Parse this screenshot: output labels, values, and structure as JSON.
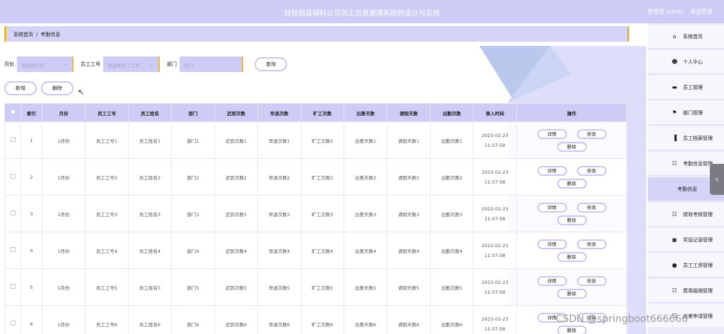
{
  "header": {
    "title": "钰铨服装辅料公司员工信息管理系统的设计与实现",
    "user_role": "管理员 admin",
    "logout": "退出登录"
  },
  "breadcrumb": {
    "home": "系统首页",
    "separator": "/",
    "current": "考勤信息"
  },
  "search": {
    "month_label": "月份",
    "month_placeholder": "请选择月份",
    "id_label": "员工工号",
    "id_placeholder": "请选择员工工号",
    "dept_label": "部门",
    "dept_placeholder": "部门",
    "search_button": "查询"
  },
  "actions": {
    "add": "新增",
    "delete": "删除"
  },
  "table": {
    "headers": [
      "索引",
      "月份",
      "员工工号",
      "员工姓名",
      "部门",
      "迟到次数",
      "早退次数",
      "旷工次数",
      "出差天数",
      "请假天数",
      "出勤次数",
      "录入时间",
      "操作"
    ],
    "op_labels": {
      "detail": "详情",
      "edit": "修改",
      "delete": "删除"
    },
    "rows": [
      [
        "1",
        "1月份",
        "员工工号1",
        "员工姓名1",
        "部门1",
        "迟到次数1",
        "早退次数1",
        "旷工次数1",
        "出差天数1",
        "请假天数1",
        "出勤次数1",
        "2023-02-23 11:07:58"
      ],
      [
        "2",
        "1月份",
        "员工工号2",
        "员工姓名2",
        "部门2",
        "迟到次数2",
        "早退次数2",
        "旷工次数2",
        "出差天数2",
        "请假天数2",
        "出勤次数2",
        "2023-02-23 11:07:58"
      ],
      [
        "3",
        "1月份",
        "员工工号3",
        "员工姓名3",
        "部门3",
        "迟到次数3",
        "早退次数3",
        "旷工次数3",
        "出差天数3",
        "请假天数3",
        "出勤次数3",
        "2023-02-23 11:07:58"
      ],
      [
        "4",
        "1月份",
        "员工工号4",
        "员工姓名4",
        "部门4",
        "迟到次数4",
        "早退次数4",
        "旷工次数4",
        "出差天数4",
        "请假天数4",
        "出勤次数4",
        "2023-02-23 11:07:58"
      ],
      [
        "5",
        "1月份",
        "员工工号5",
        "员工姓名5",
        "部门5",
        "迟到次数5",
        "早退次数5",
        "旷工次数5",
        "出差天数5",
        "请假天数5",
        "出勤次数5",
        "2023-02-23 11:07:58"
      ],
      [
        "6",
        "1月份",
        "员工工号6",
        "员工姓名6",
        "部门6",
        "迟到次数6",
        "早退次数6",
        "旷工次数6",
        "出差天数6",
        "请假天数6",
        "出勤次数6",
        "2023-02-23 11:07:58"
      ]
    ]
  },
  "sidebar": {
    "items": [
      {
        "label": "系统首页",
        "icon": "home-icon"
      },
      {
        "label": "个人中心",
        "icon": "user-icon"
      },
      {
        "label": "员工管理",
        "icon": "card-icon"
      },
      {
        "label": "部门管理",
        "icon": "flag-icon"
      },
      {
        "label": "员工档案管理",
        "icon": "bar-chart-icon"
      },
      {
        "label": "考勤信息管理",
        "icon": "grid-icon"
      },
      {
        "label": "考勤信息",
        "icon": ""
      },
      {
        "label": "绩效考核管理",
        "icon": "grid-icon"
      },
      {
        "label": "奖惩记录管理",
        "icon": "clipboard-icon"
      },
      {
        "label": "员工工资管理",
        "icon": "pin-icon"
      },
      {
        "label": "费用报销管理",
        "icon": "grid-icon"
      },
      {
        "label": "出差申请管理",
        "icon": "grid-icon"
      }
    ]
  },
  "watermark": "CSDN @springboot666666",
  "colors": {
    "primary": "#ccccf7",
    "accent": "#e7b93f",
    "sidebar_bg": "#ebebfb"
  }
}
